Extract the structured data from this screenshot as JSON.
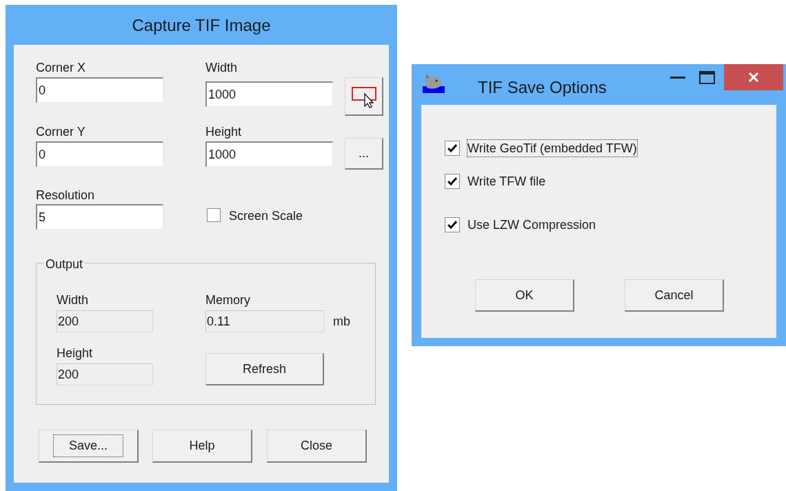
{
  "capture_dialog": {
    "title": "Capture TIF Image",
    "fields": [
      {
        "label": "Corner X",
        "value": "0"
      },
      {
        "label": "Width",
        "value": "1000"
      },
      {
        "label": "Corner Y",
        "value": "0"
      },
      {
        "label": "Height",
        "value": "1000"
      },
      {
        "label": "Resolution",
        "value": "5"
      }
    ],
    "more_button": "...",
    "screen_scale": {
      "label": "Screen Scale",
      "checked": false
    },
    "output": {
      "title": "Output",
      "width": {
        "label": "Width",
        "value": "200"
      },
      "memory": {
        "label": "Memory",
        "value": "0.11",
        "unit": "mb"
      },
      "height": {
        "label": "Height",
        "value": "200"
      },
      "refresh_button": "Refresh"
    },
    "buttons": [
      {
        "label": "Save...",
        "focused": true
      },
      {
        "label": "Help",
        "focused": false
      },
      {
        "label": "Close",
        "focused": false
      }
    ]
  },
  "save_options_dialog": {
    "title": "TIF Save Options",
    "checkboxes": [
      {
        "label": "Write GeoTif (embedded TFW)",
        "checked": true,
        "focused": true
      },
      {
        "label": "Write TFW file",
        "checked": true,
        "focused": false
      },
      {
        "label": "Use LZW Compression",
        "checked": true,
        "focused": false
      }
    ],
    "buttons": [
      "OK",
      "Cancel"
    ]
  }
}
